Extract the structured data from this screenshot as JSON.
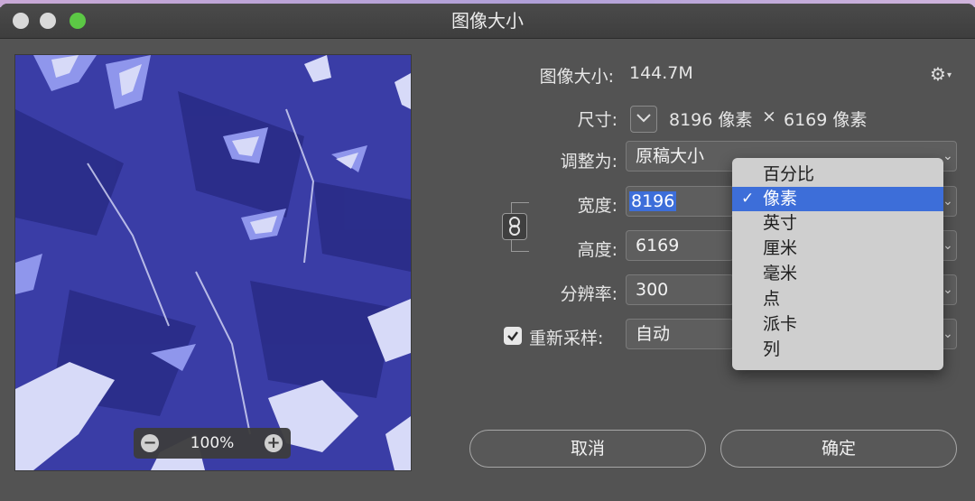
{
  "window": {
    "title": "图像大小"
  },
  "preview": {
    "zoom_level": "100%",
    "zoom_out_icon": "minus-circle-icon",
    "zoom_in_icon": "plus-circle-icon"
  },
  "info": {
    "image_size_label": "图像大小:",
    "image_size_value": "144.7M",
    "dimensions_label": "尺寸:",
    "dimensions_width": "8196 像素",
    "dimensions_sep": "×",
    "dimensions_height": "6169 像素"
  },
  "fit_to": {
    "label": "调整为:",
    "value": "原稿大小"
  },
  "width": {
    "label": "宽度:",
    "value": "8196"
  },
  "height": {
    "label": "高度:",
    "value": "6169"
  },
  "resolution": {
    "label": "分辨率:",
    "value": "300"
  },
  "resample": {
    "label": "重新采样:",
    "value": "自动",
    "checked": true
  },
  "unit_menu": {
    "items": [
      "百分比",
      "像素",
      "英寸",
      "厘米",
      "毫米",
      "点",
      "派卡",
      "列"
    ],
    "selected_index": 1,
    "check_mark": "✓"
  },
  "buttons": {
    "cancel": "取消",
    "ok": "确定"
  },
  "colors": {
    "accent": "#3d6ed9",
    "dialog_bg": "#535353",
    "preview_bg": "#3b3ea8",
    "traffic_green": "#5cc845"
  }
}
